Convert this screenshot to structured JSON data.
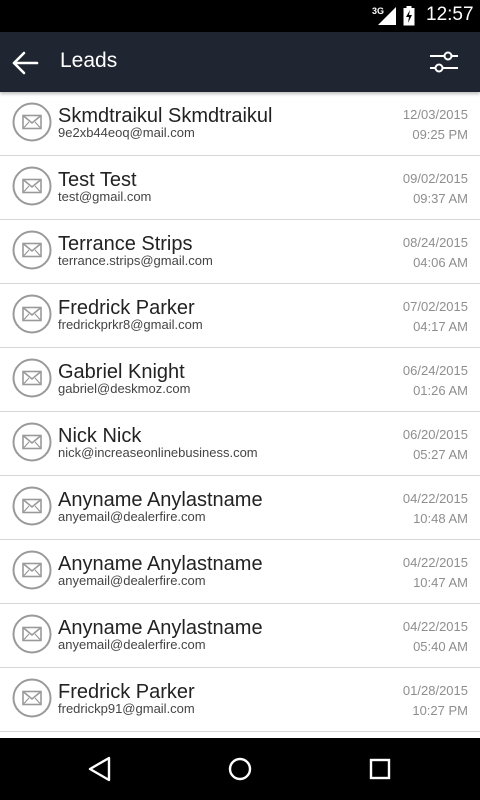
{
  "status_bar": {
    "network": "3G",
    "time": "12:57"
  },
  "toolbar": {
    "title": "Leads",
    "back_icon": "arrow-left-icon",
    "filter_icon": "sliders-icon"
  },
  "leads": [
    {
      "name": "Skmdtraikul Skmdtraikul",
      "email": "9e2xb44eoq@mail.com",
      "date": "12/03/2015",
      "time": "09:25 PM"
    },
    {
      "name": "Test Test",
      "email": "test@gmail.com",
      "date": "09/02/2015",
      "time": "09:37 AM"
    },
    {
      "name": "Terrance Strips",
      "email": "terrance.strips@gmail.com",
      "date": "08/24/2015",
      "time": "04:06 AM"
    },
    {
      "name": "Fredrick Parker",
      "email": "fredrickprkr8@gmail.com",
      "date": "07/02/2015",
      "time": "04:17 AM"
    },
    {
      "name": "Gabriel Knight",
      "email": "gabriel@deskmoz.com",
      "date": "06/24/2015",
      "time": "01:26 AM"
    },
    {
      "name": "Nick Nick",
      "email": "nick@increaseonlinebusiness.com",
      "date": "06/20/2015",
      "time": "05:27 AM"
    },
    {
      "name": "Anyname Anylastname",
      "email": "anyemail@dealerfire.com",
      "date": "04/22/2015",
      "time": "10:48 AM"
    },
    {
      "name": "Anyname Anylastname",
      "email": "anyemail@dealerfire.com",
      "date": "04/22/2015",
      "time": "10:47 AM"
    },
    {
      "name": "Anyname Anylastname",
      "email": "anyemail@dealerfire.com",
      "date": "04/22/2015",
      "time": "05:40 AM"
    },
    {
      "name": "Fredrick Parker",
      "email": "fredrickp91@gmail.com",
      "date": "01/28/2015",
      "time": "10:27 PM"
    }
  ],
  "colors": {
    "toolbar": "#1f2631",
    "status_bar": "#000000",
    "nav_bar": "#000000",
    "row_divider": "#d6d6d6",
    "meta_text": "#8e8e8e"
  },
  "nav_bar": {
    "icons": [
      "nav-back-icon",
      "nav-home-icon",
      "nav-recents-icon"
    ]
  }
}
